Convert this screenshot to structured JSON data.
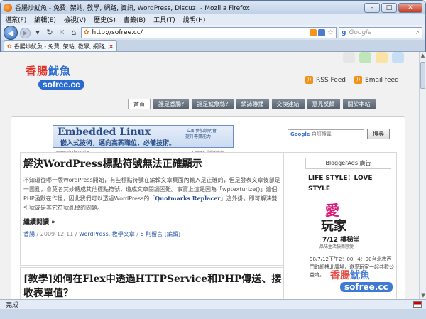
{
  "browser": {
    "window_title": "香腸炒魷魚 - 免費, 架站, 教學, 網路, 資訊, WordPress, Discuz! - Mozilla Firefox",
    "menu": [
      "檔案(F)",
      "編輯(E)",
      "檢視(V)",
      "歷史(S)",
      "書籤(B)",
      "工具(T)",
      "說明(H)"
    ],
    "url": "http://sofree.cc/",
    "search_placeholder": "Google",
    "search_engine": "g",
    "tab_title": "香腸炒魷魚 - 免費, 架站, 教學, 網路, 資...",
    "status": "完成"
  },
  "site": {
    "logo_cn_red": "香腸",
    "logo_cn_blue": "魷魚",
    "logo_en": "sofree.cc",
    "swatch_colors": [
      "#e6e6e6",
      "#bfe6b8",
      "#fbe3a6",
      "#c7def7"
    ],
    "feeds": [
      {
        "icon": "rss-icon",
        "label": "RSS Feed"
      },
      {
        "icon": "email-icon",
        "label": "Email feed"
      }
    ],
    "nav": [
      "首頁",
      "誰是香腸?",
      "誰是魷魚絲?",
      "網誌聯播",
      "交換連結",
      "意見反饋",
      "關於本站"
    ],
    "banner": {
      "line1": "Embedded Linux",
      "line2": "嵌入式技術，邁向高薪職位，必備技術。",
      "cta1": "立即參加說明會",
      "cta2": "提升專業能力",
      "url": "www.odpda.org.tw",
      "ads_label": "Google 提供的廣告"
    },
    "posts": [
      {
        "title": "解決WordPress標點符號無法正確顯示",
        "body_a": "不知道從哪一版WordPress開始，有些標點符號在編輯文章頁面內輸入是正確的，但是發表文章後卻是一團亂，會莫名其妙轉成其他標點符號，造成文章閱讀困難。事實上這是因為「wptexturize()」這個PHP函數在作怪，因此我們可以透過WordPress的「",
        "plugin": "Quotmarks Replacer",
        "body_b": "」這外掛，即可解決雙引號或是其它符號亂掉的問題。",
        "more": "繼續閱讀 »",
        "author": "香腸",
        "date": "2009-12-11",
        "categories": "WordPress, 教學文章",
        "comments": "6 則留言",
        "edit": "[編輯]"
      },
      {
        "title": "[教學]如何在Flex中透過HTTPService和PHP傳送、接收表單值？"
      }
    ],
    "sidebar": {
      "search_hint": "自訂搜尋",
      "search_button": "搜尋",
      "ad_header": "BloggerAds 廣告",
      "ad_headline": "LIFE STYLE：LOVE STYLE",
      "ad_art_1": "愛",
      "ad_art_2": "玩家",
      "ad_art_3": "7/12 樓梯堂",
      "ad_art_4": "品味生活快樂戀愛",
      "ad_text": "98/7/12下午2：00~4：00台北市西門町紅樓北廣場，邀愛玩家一起共歡公益唷。"
    }
  }
}
